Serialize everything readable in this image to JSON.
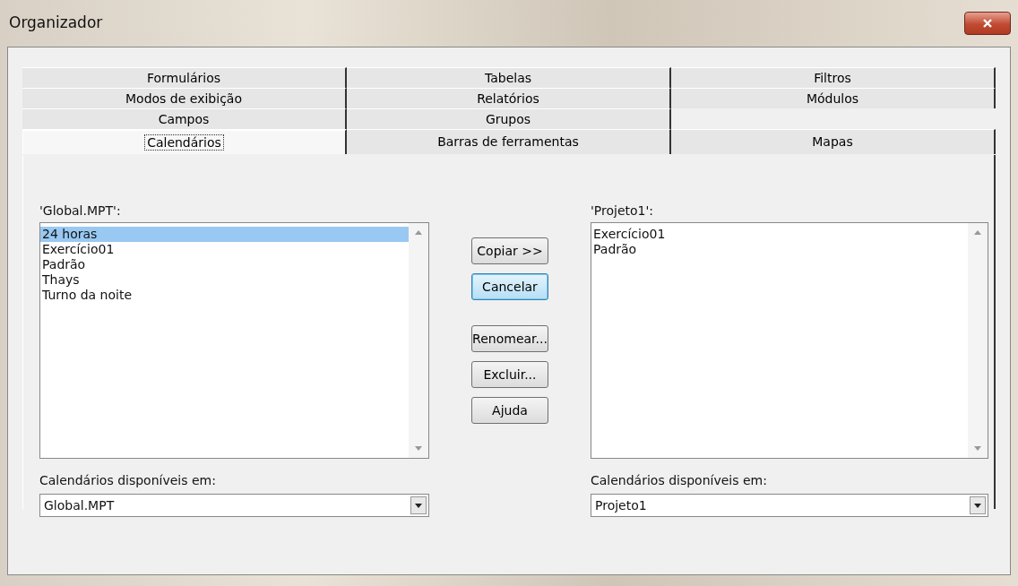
{
  "window": {
    "title": "Organizador"
  },
  "tab_rows": [
    {
      "tabs": [
        {
          "label": "Formulários",
          "selected": false
        },
        {
          "label": "Tabelas",
          "selected": false
        },
        {
          "label": "Filtros",
          "selected": false
        }
      ]
    },
    {
      "tabs": [
        {
          "label": "Modos de exibição",
          "selected": false
        },
        {
          "label": "Relatórios",
          "selected": false
        },
        {
          "label": "Módulos",
          "selected": false
        }
      ]
    },
    {
      "tabs": [
        {
          "label": "Campos",
          "selected": false
        },
        {
          "label": "Grupos",
          "selected": false
        }
      ]
    },
    {
      "tabs": [
        {
          "label": "Calendários",
          "selected": true
        },
        {
          "label": "Barras de ferramentas",
          "selected": false
        },
        {
          "label": "Mapas",
          "selected": false
        }
      ]
    }
  ],
  "left": {
    "label": "'Global.MPT':",
    "items": [
      {
        "text": "24 horas",
        "selected": true
      },
      {
        "text": "Exercício01",
        "selected": false
      },
      {
        "text": "Padrão",
        "selected": false
      },
      {
        "text": "Thays",
        "selected": false
      },
      {
        "text": "Turno da noite",
        "selected": false
      }
    ],
    "source_label": "Calendários disponíveis em:",
    "source_value": "Global.MPT"
  },
  "buttons": [
    {
      "label": "Copiar >>",
      "default": false
    },
    {
      "label": "Cancelar",
      "default": true
    },
    {
      "label": "Renomear...",
      "default": false
    },
    {
      "label": "Excluir...",
      "default": false
    },
    {
      "label": "Ajuda",
      "default": false
    }
  ],
  "right": {
    "label": "'Projeto1':",
    "items": [
      {
        "text": "Exercício01",
        "selected": false
      },
      {
        "text": "Padrão",
        "selected": false
      }
    ],
    "source_label": "Calendários disponíveis em:",
    "source_value": "Projeto1"
  }
}
